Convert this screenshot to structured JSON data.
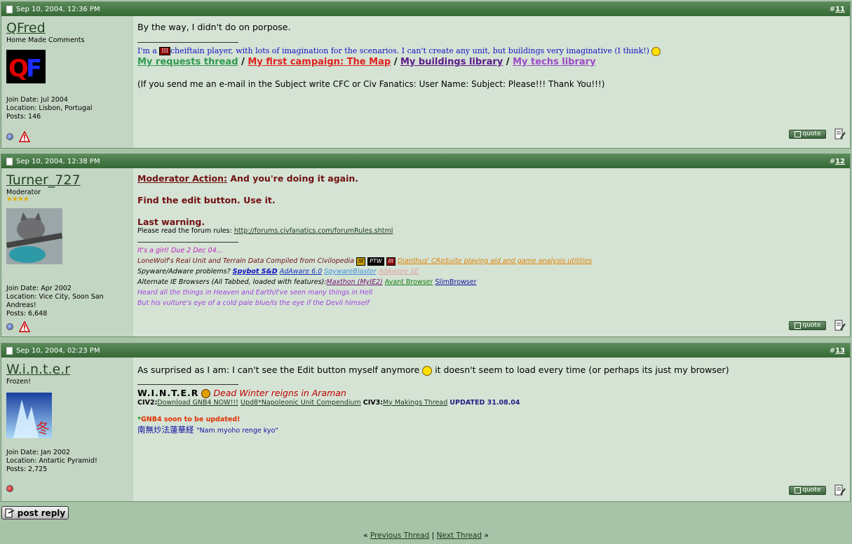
{
  "posts": [
    {
      "date": "Sep 10, 2004, 12:36 PM",
      "number": "11",
      "username": "QFred",
      "user_title": "Home Made Comments",
      "join_date": "Join Date: Jul 2004",
      "location": "Location: Lisbon, Portugal",
      "posts": "Posts: 146",
      "message": "By the way, I didn't do on porpose.",
      "sig_line1_pre": "I'm a ",
      "sig_badge": "III",
      "sig_line1_post": "cheiftain player, with lots of imagination for the scenarios. I can't create any unit, but buildings very imaginative (I think!)",
      "sig_links": [
        "My requests thread",
        "My first campaign: The Map",
        "My buildings library",
        "My techs library"
      ],
      "sig_sep": "/",
      "sig_note": "(If you send me an e-mail in the Subject write CFC or Civ Fanatics: User Name: Subject: Please!!! Thank You!!!)"
    },
    {
      "date": "Sep 10, 2004, 12:38 PM",
      "number": "12",
      "username": "Turner_727",
      "user_title": "Moderator",
      "stars": "★★★★",
      "join_date": "Join Date: Apr 2002",
      "location": "Location: Vice City, Soon San Andreas!",
      "posts": "Posts: 6,648",
      "mod_action_label": "Moderator Action:",
      "mod_action_text": " And you're doing it again.",
      "find_edit": "Find the edit button. Use it.",
      "last_warning": "Last warning.",
      "rules_pre": "Please read the forum rules: ",
      "rules_link": "http://forums.civfanatics.com/forumRules.shtml",
      "sig1": "It's a girl! Due 2 Dec 04...",
      "sig2_pre": "LoneWolf's Real Unit and Terrain Data Compiled from Civilopedia ",
      "sig2_badges": [
        "III",
        "PTW",
        "III"
      ],
      "sig2_link": "Dianthus' CRpSuite playing aid and game analysis utilities",
      "sig3_pre": "Spyware/Adware problems? ",
      "sig3_links": [
        "Spybot S&D",
        "AdAware 6.0",
        "SpywareBlaster",
        "AdAware SE"
      ],
      "sig4_pre": "Alternate IE Browsers (All Tabbed, loaded with features):",
      "sig4_links": [
        "Maxthon (MyIE2)",
        "Avant Browser",
        "SlimBrowser"
      ],
      "sig5": "Heard all the things in Heaven and Earth/I've seen many things in Hell",
      "sig6": "But his vulture's eye of a cold pale blue/Is the eye if the Devil himself"
    },
    {
      "date": "Sep 10, 2004, 02:23 PM",
      "number": "13",
      "username": "W.i.n.t.e.r",
      "user_title": "Frozen!",
      "join_date": "Join Date: Jan 2002",
      "location": "Location: Antartic Pyramid!",
      "posts": "Posts: 2,725",
      "message_pre": "As surprised as I am: I can't see the Edit button myself anymore ",
      "message_post": " it doesn't seem to load every time (or perhaps its just my browser)",
      "sig_name": "W.I.N.T.E.R",
      "sig_tag": "Dead Winter reigns in Araman",
      "civ2_label": "CIV2:",
      "civ2_links": [
        "Download GNB4 NOW!!!",
        "Upd8*Napoleonic Unit Compendium"
      ],
      "civ3_label": "CIV3:",
      "civ3_link": "My Makings Thread",
      "updated": "UPDATED 31.08.04",
      "gnb4_star": "*",
      "gnb4": "GNB4 soon to be updated!",
      "jp": "南無炒法蓮華経",
      "jp_romaji": "\"Nam myoho renge kyo\""
    }
  ],
  "quote_label": "quote",
  "post_reply_label": "post reply",
  "nav": {
    "prev_arrow": "«",
    "prev": "Previous Thread",
    "sep": "|",
    "next": "Next Thread",
    "next_arrow": "»"
  },
  "colors": {
    "header": "#356835",
    "sidebar": "#c3d5c3",
    "content": "#d5e3d5",
    "page": "#a8c4a8"
  }
}
